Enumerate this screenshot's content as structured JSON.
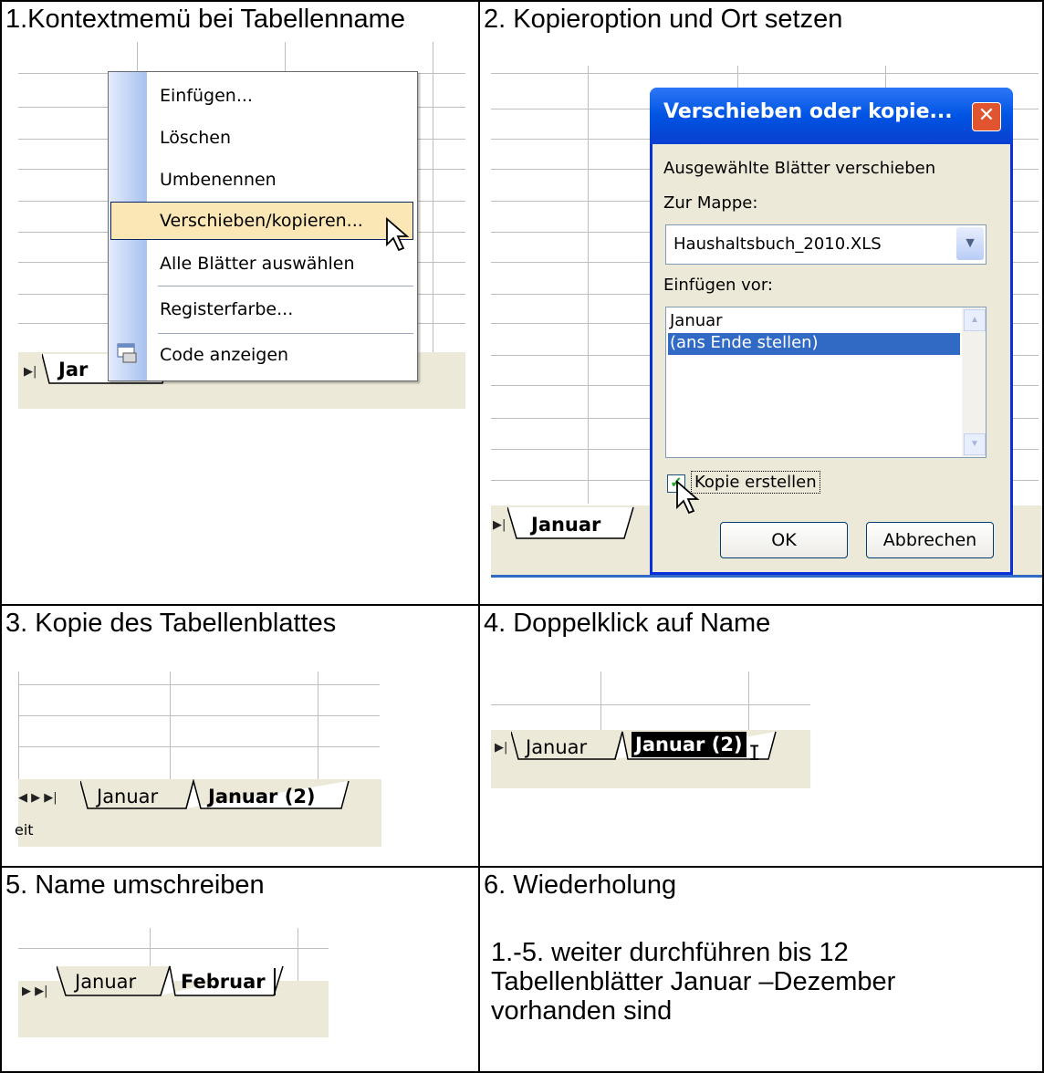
{
  "steps": {
    "s1": {
      "title": "1.Kontextmemü bei Tabellenname"
    },
    "s2": {
      "title": "2. Kopieroption und Ort setzen"
    },
    "s3": {
      "title": "3. Kopie des Tabellenblattes"
    },
    "s4": {
      "title": "4. Doppelklick auf Name"
    },
    "s5": {
      "title": "5. Name umschreiben"
    },
    "s6": {
      "title": "6. Wiederholung",
      "text_l1": "1.-5. weiter durchführen bis 12",
      "text_l2": "Tabellenblätter Januar –Dezember",
      "text_l3": "vorhanden sind"
    }
  },
  "context_menu": {
    "items": [
      {
        "label": "Einfügen..."
      },
      {
        "label": "Löschen"
      },
      {
        "label": "Umbenennen"
      },
      {
        "label": "Verschieben/kopieren..."
      },
      {
        "label": "Alle Blätter auswählen"
      },
      {
        "label": "Registerfarbe..."
      },
      {
        "label": "Code anzeigen"
      }
    ],
    "highlighted_index": 3
  },
  "dialog": {
    "title": "Verschieben oder kopie...",
    "move_label": "Ausgewählte Blätter verschieben",
    "to_book_label": "Zur Mappe:",
    "book_value": "Haushaltsbuch_2010.XLS",
    "before_label": "Einfügen vor:",
    "sheet_list": [
      "Januar",
      "(ans Ende stellen)"
    ],
    "selected_index": 1,
    "copy_label": "Kopie erstellen",
    "copy_checked": true,
    "ok_label": "OK",
    "cancel_label": "Abbrechen"
  },
  "tabs": {
    "p1_tab": "Jar",
    "p2_tab": "Januar",
    "p3_tab1": "Januar",
    "p3_tab2": "Januar (2)",
    "p3_status": "eit",
    "p4_tab1": "Januar",
    "p4_tab2": "Januar (2)",
    "p5_tab1": "Januar",
    "p5_tab2": "Februar"
  },
  "colors": {
    "selection": "#316ac5",
    "menu_highlight": "#fbe7b5",
    "dialog_title": "#0a246a",
    "tabbar": "#ece9d8"
  }
}
